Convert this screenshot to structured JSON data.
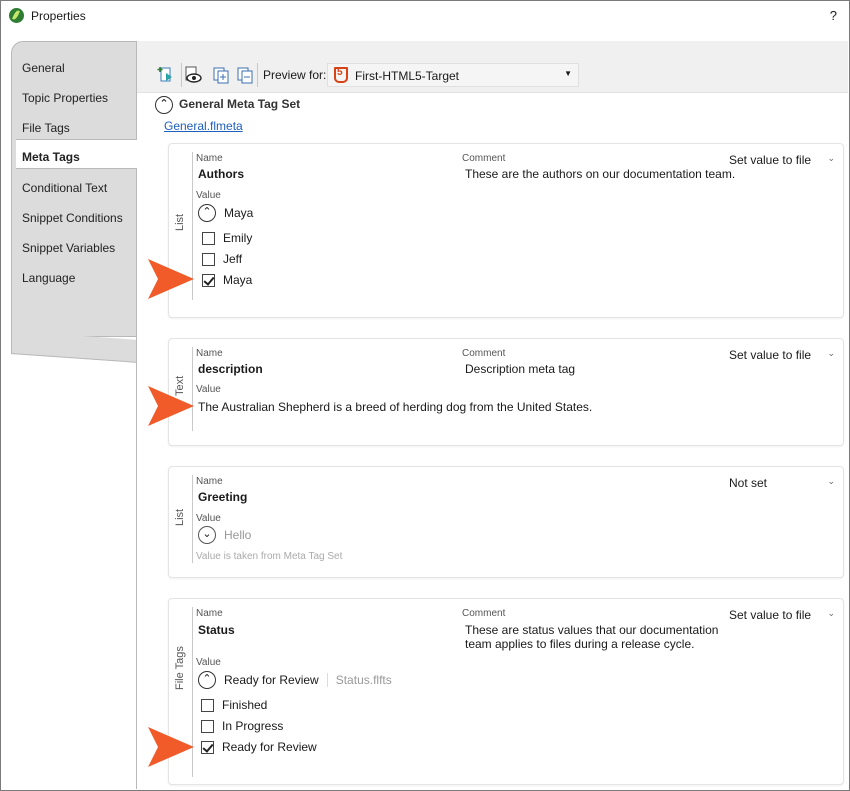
{
  "window": {
    "title": "Properties",
    "help": "?"
  },
  "tabs": [
    {
      "label": "General"
    },
    {
      "label": "Topic Properties"
    },
    {
      "label": "File Tags"
    },
    {
      "label": "Meta Tags",
      "active": true
    },
    {
      "label": "Conditional Text"
    },
    {
      "label": "Snippet Conditions"
    },
    {
      "label": "Snippet Variables"
    },
    {
      "label": "Language"
    }
  ],
  "toolbar": {
    "preview_label": "Preview for:",
    "preview_target": "First-HTML5-Target",
    "icons": [
      "add-meta-tag-icon",
      "preview-icon",
      "copy-icon",
      "paste-icon"
    ]
  },
  "meta_set": {
    "title": "General Meta Tag Set",
    "file_link": "General.flmeta"
  },
  "labels": {
    "name": "Name",
    "comment": "Comment",
    "value": "Value"
  },
  "cards": {
    "authors": {
      "type": "List",
      "name": "Authors",
      "comment": "These are the authors on our documentation team.",
      "setting": "Set value to file",
      "selected": "Maya",
      "options": [
        {
          "label": "Emily",
          "checked": false
        },
        {
          "label": "Jeff",
          "checked": false
        },
        {
          "label": "Maya",
          "checked": true
        }
      ]
    },
    "description": {
      "type": "Text",
      "name": "description",
      "comment": "Description meta tag",
      "setting": "Set value to file",
      "value": "The Australian Shepherd is a breed of herding dog from the United States."
    },
    "greeting": {
      "type": "List",
      "name": "Greeting",
      "setting": "Not set",
      "selected": "Hello",
      "note": "Value is taken from Meta Tag Set"
    },
    "status": {
      "type": "File Tags",
      "name": "Status",
      "comment": "These are status values that our documentation team applies to files during a release cycle.",
      "setting": "Set value to file",
      "selected": "Ready for Review",
      "source_file": "Status.flfts",
      "options": [
        {
          "label": "Finished",
          "checked": false
        },
        {
          "label": "In Progress",
          "checked": false
        },
        {
          "label": "Ready for Review",
          "checked": true
        }
      ]
    }
  },
  "colors": {
    "arrow": "#f15a29",
    "link": "#1e5fbf",
    "tab_bg": "#dcdcdc"
  }
}
